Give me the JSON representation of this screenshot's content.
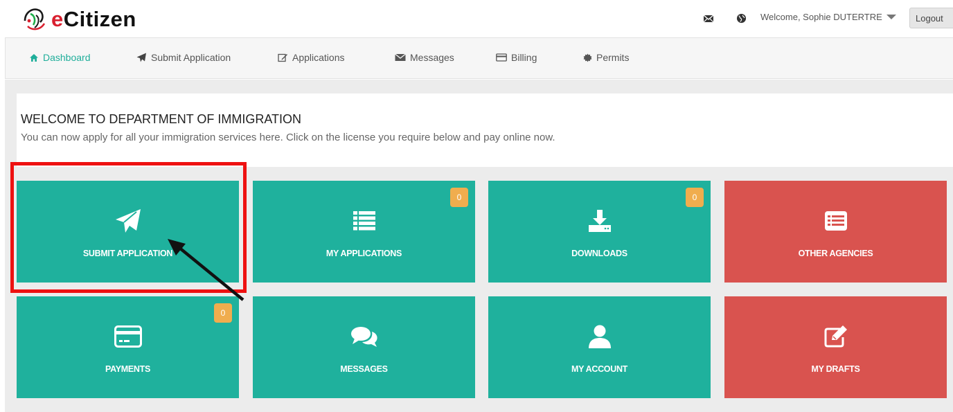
{
  "header": {
    "logo_text_e": "e",
    "logo_text_rest": "Citizen",
    "welcome_text": "Welcome, Sophie DUTERTRE",
    "logout_label": "Logout"
  },
  "nav": {
    "items": [
      {
        "label": "Dashboard",
        "icon": "home-icon"
      },
      {
        "label": "Submit Application",
        "icon": "paper-plane-icon"
      },
      {
        "label": "Applications",
        "icon": "edit-icon"
      },
      {
        "label": "Messages",
        "icon": "envelope-icon"
      },
      {
        "label": "Billing",
        "icon": "credit-card-icon"
      },
      {
        "label": "Permits",
        "icon": "certificate-icon"
      }
    ]
  },
  "welcome": {
    "title": "WELCOME TO DEPARTMENT OF IMMIGRATION",
    "subtitle": "You can now apply for all your immigration services here. Click on the license you require below and pay online now."
  },
  "tiles": [
    {
      "label": "SUBMIT APPLICATION",
      "icon": "paper-plane-icon",
      "color": "#1fb19d"
    },
    {
      "label": "MY APPLICATIONS",
      "icon": "list-icon",
      "color": "#1fb19d",
      "badge": "0"
    },
    {
      "label": "DOWNLOADS",
      "icon": "download-icon",
      "color": "#1fb19d",
      "badge": "0"
    },
    {
      "label": "OTHER AGENCIES",
      "icon": "list-alt-icon",
      "color": "#d9534f"
    },
    {
      "label": "PAYMENTS",
      "icon": "credit-card-icon",
      "color": "#1fb19d",
      "badge": "0"
    },
    {
      "label": "MESSAGES",
      "icon": "comments-icon",
      "color": "#1fb19d"
    },
    {
      "label": "MY ACCOUNT",
      "icon": "user-icon",
      "color": "#1fb19d"
    },
    {
      "label": "MY DRAFTS",
      "icon": "edit-icon",
      "color": "#d9534f"
    }
  ],
  "colors": {
    "accent": "#1fb19d",
    "danger": "#d9534f",
    "badge": "#f0ad4e",
    "highlight": "#ee1111"
  }
}
